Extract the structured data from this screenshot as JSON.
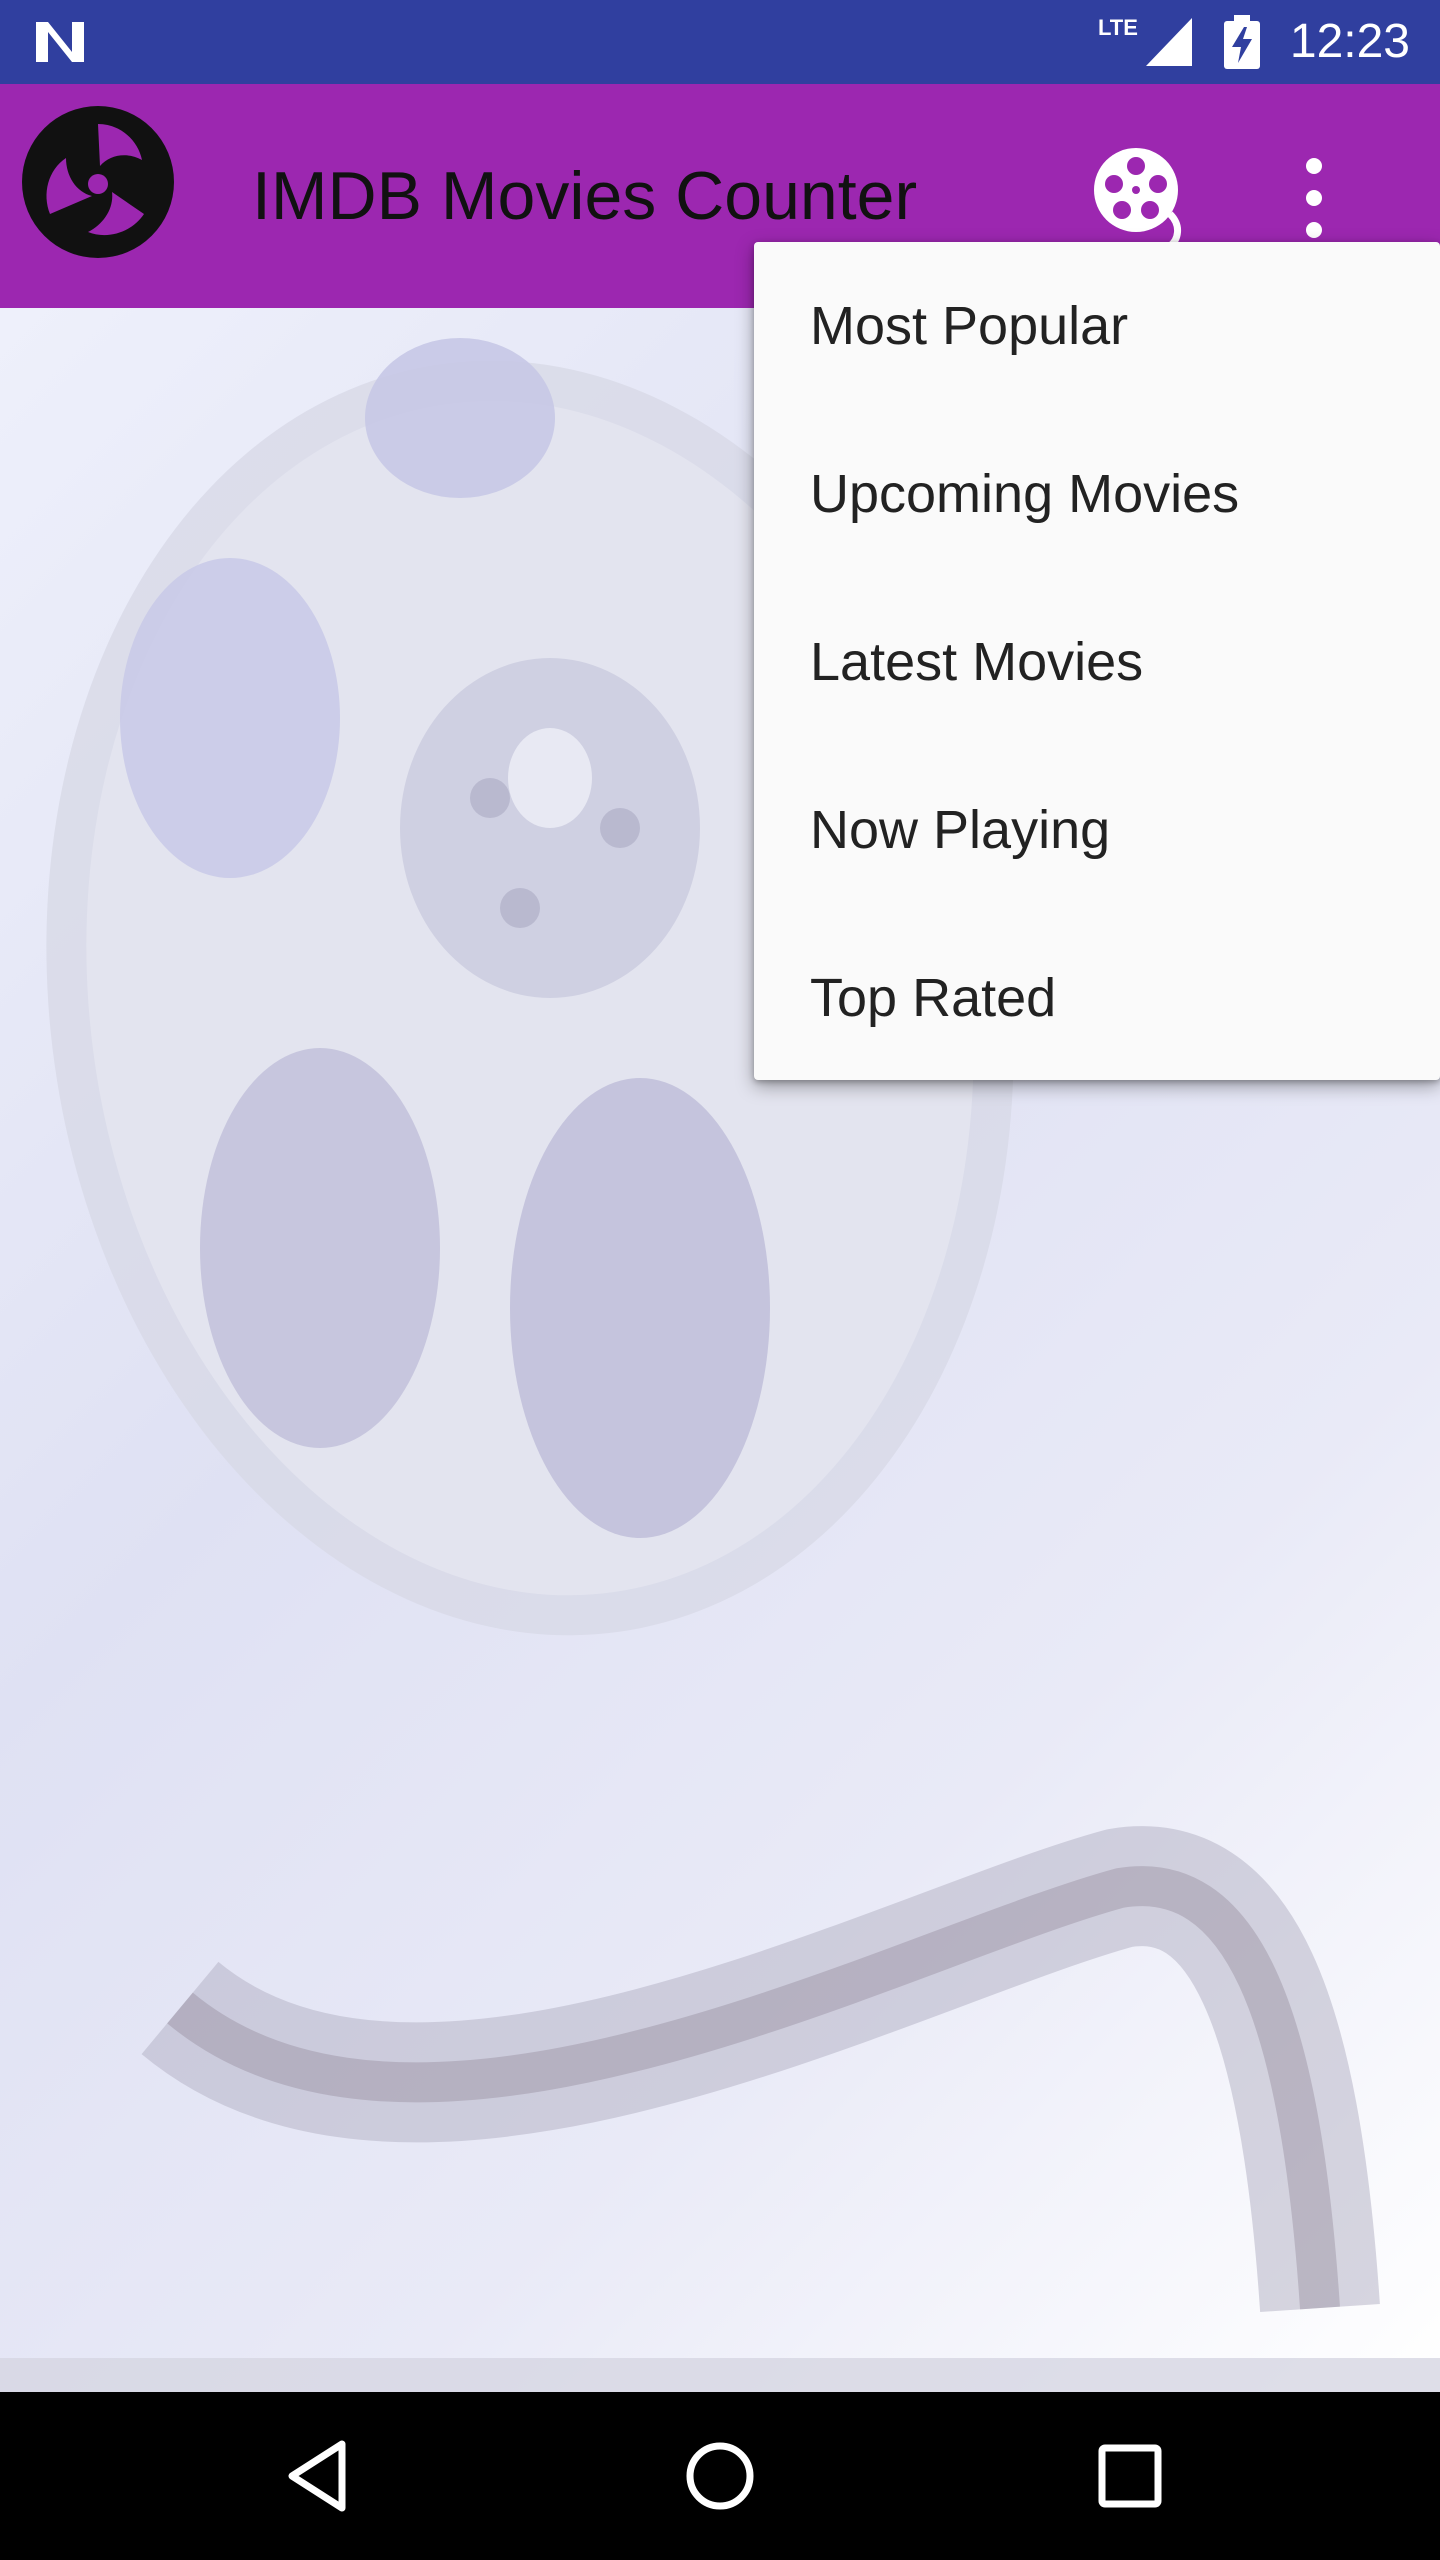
{
  "status_bar": {
    "network_label": "LTE",
    "time": "12:23",
    "background": "#303F9F",
    "icons": [
      "notification-n-icon",
      "signal-icon",
      "battery-charging-icon"
    ]
  },
  "app_bar": {
    "title": "IMDB Movies Counter",
    "background": "#9C27B0",
    "icons": [
      "app-logo-icon",
      "film-reel-icon",
      "more-vert-icon"
    ]
  },
  "menu": {
    "items": [
      {
        "label": "Most Popular"
      },
      {
        "label": "Upcoming Movies"
      },
      {
        "label": "Latest Movies"
      },
      {
        "label": "Now Playing"
      },
      {
        "label": "Top Rated"
      }
    ]
  },
  "nav_bar": {
    "icons": [
      "back-icon",
      "home-icon",
      "recents-icon"
    ]
  }
}
